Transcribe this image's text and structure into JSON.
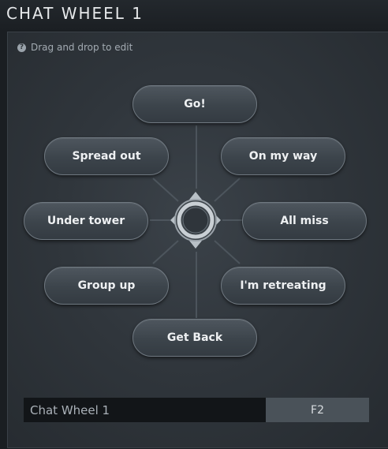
{
  "window": {
    "title": "CHAT WHEEL 1"
  },
  "hint": {
    "icon": "help-icon",
    "text": "Drag and drop to edit"
  },
  "wheel": {
    "center_icon": "compass-ring-icon",
    "items": [
      {
        "label": "Go!"
      },
      {
        "label": "On my way"
      },
      {
        "label": "All miss"
      },
      {
        "label": "I'm retreating"
      },
      {
        "label": "Get Back"
      },
      {
        "label": "Group up"
      },
      {
        "label": "Under tower"
      },
      {
        "label": "Spread out"
      }
    ]
  },
  "footer": {
    "wheel_name": "Chat Wheel 1",
    "hotkey": "F2"
  }
}
